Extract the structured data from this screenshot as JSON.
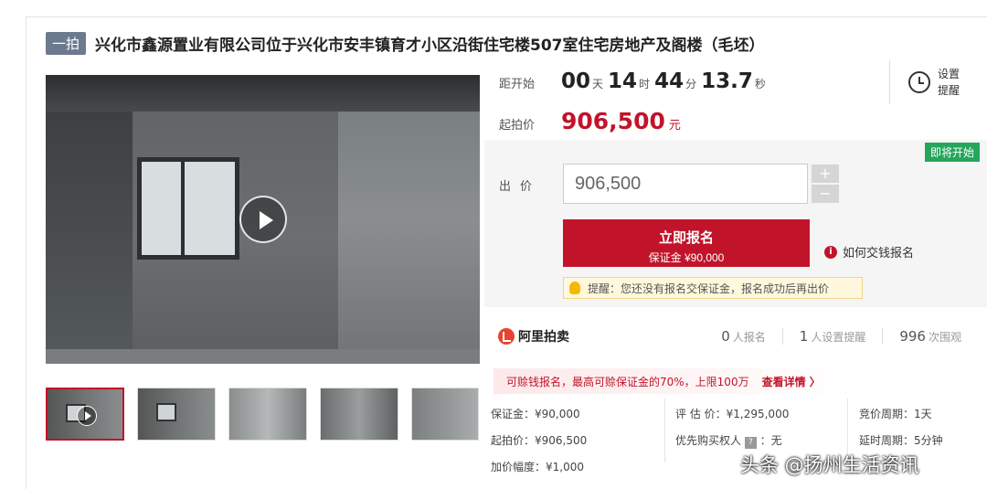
{
  "header": {
    "badge": "一拍",
    "title": "兴化市鑫源置业有限公司位于兴化市安丰镇育才小区沿街住宅楼507室住宅房地产及阁楼（毛坯）"
  },
  "countdown": {
    "label": "距开始",
    "days": "00",
    "days_unit": "天",
    "hours": "14",
    "hours_unit": "时",
    "minutes": "44",
    "minutes_unit": "分",
    "seconds": "13.7",
    "seconds_unit": "秒"
  },
  "reminder": {
    "label": "设置提醒"
  },
  "start_price": {
    "label": "起拍价",
    "value": "906,500",
    "unit": "元"
  },
  "bid": {
    "status_tag": "即将开始",
    "label": "出价",
    "value": "906,500",
    "plus": "+",
    "minus": "−",
    "signup_label": "立即报名",
    "deposit_label": "保证金 ¥90,000",
    "howto_label": "如何交钱报名",
    "tip_label": "提醒：您还没有报名交保证金，报名成功后再出价"
  },
  "platform": {
    "name": "阿里拍卖",
    "signups_count": "0",
    "signups_label": "人报名",
    "reminders_count": "1",
    "reminders_label": "人设置提醒",
    "views_count": "996",
    "views_label": "次围观"
  },
  "notice": {
    "text": "可赊钱报名，最高可赊保证金的70%，上限100万",
    "link": "查看详情 〉"
  },
  "details": {
    "deposit": "保证金：¥90,000",
    "start_price": "起拍价：¥906,500",
    "increment": "加价幅度：¥1,000",
    "appraisal": "评 估 价：¥1,295,000",
    "priority_buyer": "优先购买权人",
    "priority_value": "：无",
    "priority_tag": "?",
    "cycle": "竞价周期：1天",
    "delay": "延时周期：5分钟"
  },
  "watermark": "头条 @扬州生活资讯",
  "colors": {
    "accent": "#c1142a",
    "status_green": "#26a65b",
    "badge": "#6c7a8f"
  },
  "icons": [
    "play-icon",
    "alarm-clock-icon",
    "info-icon",
    "bulb-icon",
    "alibaba-auction-logo",
    "help-icon"
  ]
}
